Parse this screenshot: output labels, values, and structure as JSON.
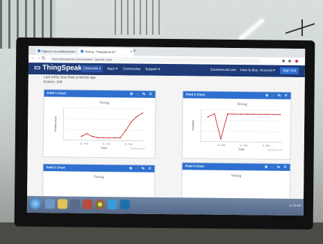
{
  "browser": {
    "tabs": [
      {
        "label": "Signed in as pubbawarnam"
      },
      {
        "label": "Testing - ThingSpeak IoT"
      }
    ],
    "url": "https://thingspeak.com/channels/...#private_view"
  },
  "nav": {
    "logo": "ThingSpeak",
    "trademark": "™",
    "items": [
      {
        "label": "Channels ▾"
      },
      {
        "label": "Apps ▾"
      },
      {
        "label": "Community"
      },
      {
        "label": "Support ▾"
      },
      {
        "label": "Commercial Use"
      },
      {
        "label": "How to Buy"
      },
      {
        "label": "Account ▾"
      },
      {
        "label": "Sign Out"
      }
    ]
  },
  "channel": {
    "last_entry": "Last entry:  less than a minute ago",
    "entries": "Entries: 159"
  },
  "panels": [
    {
      "title": "Field 1 Chart",
      "chart_title": "Testing",
      "xlabel": "Date",
      "ylabel": "Temperature",
      "credit": "ThingSpeak.com"
    },
    {
      "title": "Field 2 Chart",
      "chart_title": "Testing",
      "xlabel": "Date",
      "ylabel": "Humidity",
      "credit": "ThingSpeak.com"
    },
    {
      "title": "Field 3 Chart",
      "chart_title": "Testing"
    },
    {
      "title": "Field 4 Chart",
      "chart_title": "Testing"
    }
  ],
  "panel_icons": [
    "external-link-icon",
    "comment-icon",
    "pencil-icon",
    "close-icon"
  ],
  "panel_icon_glyphs": "⧉ ◌ ✎ ✕",
  "chart_data": [
    {
      "type": "line",
      "title": "Testing",
      "xlabel": "Date",
      "ylabel": "Temperature",
      "x": [
        "10:50",
        "11:00",
        "11:10",
        "11:20",
        "11:30"
      ],
      "series": [
        {
          "values": [
            null,
            null,
            1.0,
            3.5,
            1.0,
            0,
            0,
            0,
            0,
            0,
            7.0,
            15.0,
            20.0,
            23.0
          ]
        }
      ],
      "x_ticks": [
        "11. Feb",
        "11. Feb",
        "11. Feb"
      ]
    },
    {
      "type": "line",
      "title": "Testing",
      "xlabel": "Date",
      "ylabel": "Humidity",
      "x": [
        "10:50",
        "11:00",
        "11:10",
        "11:20",
        "11:30"
      ],
      "series": [
        {
          "values": [
            61,
            62,
            54,
            62,
            62,
            62,
            62,
            62,
            62,
            62,
            62,
            62
          ]
        }
      ],
      "x_ticks": [
        "11. Mar",
        "11. Mar",
        "11. Mar"
      ]
    }
  ],
  "taskbar": {
    "tray": "11:30 AM"
  },
  "colors": {
    "ts_nav": "#1e3b78",
    "panel_head": "#2e6fcf",
    "line": "#c8242a"
  }
}
